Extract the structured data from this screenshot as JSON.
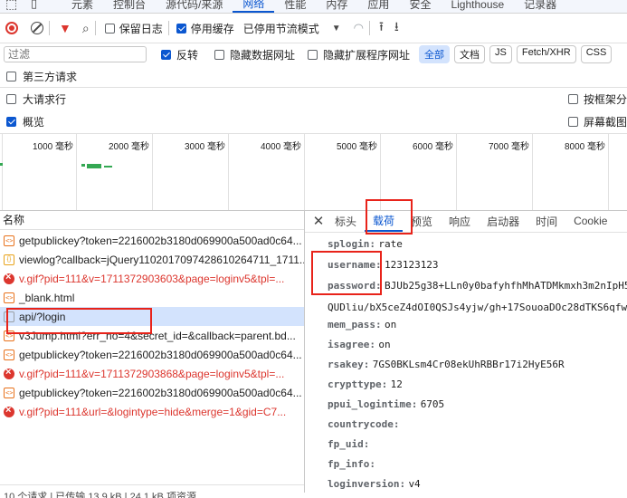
{
  "top_tabs": [
    "元素",
    "控制台",
    "源代码/来源",
    "网络",
    "性能",
    "内存",
    "应用",
    "安全",
    "Lighthouse",
    "记录器"
  ],
  "active_top_tab": "网络",
  "toolbar": {
    "preserve_log": "保留日志",
    "disable_cache": "停用缓存",
    "throttle": "已停用节流模式"
  },
  "filter_bar": {
    "placeholder": "过滤",
    "invert": "反转",
    "hide_data_urls": "隐藏数据网址",
    "hide_ext_urls": "隐藏扩展程序网址",
    "types": [
      "全部",
      "文档",
      "JS",
      "Fetch/XHR",
      "CSS"
    ],
    "active_type": "全部"
  },
  "options": {
    "third_party": "第三方请求",
    "big_rows": "大请求行",
    "group_by_frame": "按框架分",
    "overview": "概览",
    "screenshots": "屏幕截图"
  },
  "timeline_ticks": [
    "1000 毫秒",
    "2000 毫秒",
    "3000 毫秒",
    "4000 毫秒",
    "5000 毫秒",
    "6000 毫秒",
    "7000 毫秒",
    "8000 毫秒"
  ],
  "list_header": "名称",
  "requests": [
    {
      "name": "getpublickey?token=2216002b3180d069900a500ad0c64...",
      "icon": "doc",
      "error": false
    },
    {
      "name": "viewlog?callback=jQuery1102017097428610264711_1711...",
      "icon": "js",
      "error": false
    },
    {
      "name": "v.gif?pid=111&v=1711372903603&page=loginv5&tpl=...",
      "icon": "err",
      "error": true
    },
    {
      "name": "_blank.html",
      "icon": "doc",
      "error": false
    },
    {
      "name": "api/?login",
      "icon": "blank",
      "error": false
    },
    {
      "name": "v3Jump.html?err_no=4&secret_id=&callback=parent.bd...",
      "icon": "doc",
      "error": false
    },
    {
      "name": "getpublickey?token=2216002b3180d069900a500ad0c64...",
      "icon": "doc",
      "error": false
    },
    {
      "name": "v.gif?pid=111&v=1711372903868&page=loginv5&tpl=...",
      "icon": "err",
      "error": true
    },
    {
      "name": "getpublickey?token=2216002b3180d069900a500ad0c64...",
      "icon": "doc",
      "error": false
    },
    {
      "name": "v.gif?pid=111&url=&logintype=hide&merge=1&gid=C7...",
      "icon": "err",
      "error": true
    }
  ],
  "status_bar": "10 个请求 | 已传输 13.9 kB | 24.1 kB 项资源",
  "detail_tabs": [
    "标头",
    "载荷",
    "预览",
    "响应",
    "启动器",
    "时间",
    "Cookie"
  ],
  "active_detail_tab": "载荷",
  "payload": [
    {
      "key": "splogin:",
      "value": "rate"
    },
    {
      "key": "username:",
      "value": "123123123"
    },
    {
      "key": "password:",
      "value": "BJUb25g38+LLn0y0bafyhfhMhATDMkmxh3m2nIpH5"
    },
    {
      "key": "",
      "value": "QUDliu/bX5ceZ4dOI0QSJs4yjw/gh+17SouoaDOc28dTKS6qfw"
    },
    {
      "key": "mem_pass:",
      "value": "on"
    },
    {
      "key": "isagree:",
      "value": "on"
    },
    {
      "key": "rsakey:",
      "value": "7GS0BKLsm4Cr08ekUhRBBr17i2HyE56R"
    },
    {
      "key": "crypttype:",
      "value": "12"
    },
    {
      "key": "ppui_logintime:",
      "value": "6705"
    },
    {
      "key": "countrycode:",
      "value": ""
    },
    {
      "key": "fp_uid:",
      "value": ""
    },
    {
      "key": "fp_info:",
      "value": ""
    },
    {
      "key": "loginversion:",
      "value": "v4"
    }
  ],
  "colors": {
    "accent": "#0b57d0",
    "error": "#dc362e",
    "highlight": "#e8231a",
    "selected_row": "#d3e3fd"
  }
}
